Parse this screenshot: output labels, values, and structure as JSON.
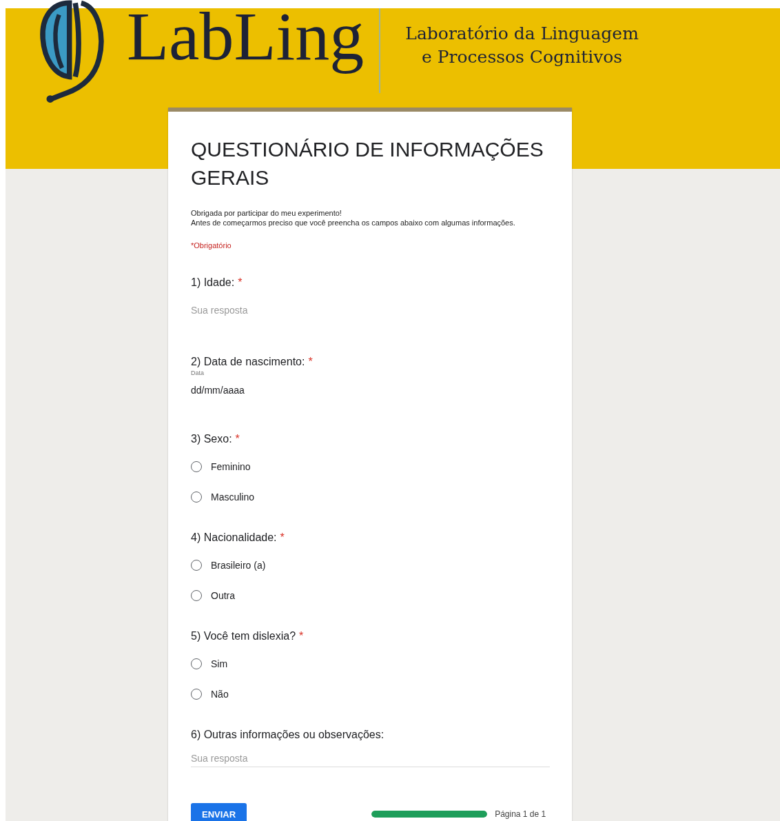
{
  "header": {
    "logo_text": "LabLing",
    "subtitle_lines": [
      "Laboratório da Linguagem",
      "e Processos Cognitivos"
    ]
  },
  "form": {
    "title": "QUESTIONÁRIO DE INFORMAÇÕES GERAIS",
    "description_lines": [
      "Obrigada por participar do meu experimento!",
      "Antes de começarmos preciso que você preencha os campos abaixo com algumas informações."
    ],
    "required_note": "*Obrigatório",
    "questions": [
      {
        "kind": "text",
        "label": "1) Idade:",
        "required_mark": "*",
        "placeholder": "Sua resposta"
      },
      {
        "kind": "date",
        "label": "2) Data de nascimento:",
        "required_mark": "*",
        "sublabel": "Data",
        "value": "dd/mm/aaaa"
      },
      {
        "kind": "radio",
        "label": "3) Sexo:",
        "required_mark": "*",
        "options": [
          {
            "label": "Feminino",
            "selected": false
          },
          {
            "label": "Masculino",
            "selected": false
          }
        ]
      },
      {
        "kind": "radio",
        "label": "4) Nacionalidade:",
        "required_mark": "*",
        "options": [
          {
            "label": "Brasileiro (a)",
            "selected": false
          },
          {
            "label": "Outra",
            "selected": false
          }
        ]
      },
      {
        "kind": "radio",
        "label": "5) Você tem dislexia?",
        "required_mark": "*",
        "options": [
          {
            "label": "Sim",
            "selected": false
          },
          {
            "label": "Não",
            "selected": false
          }
        ]
      },
      {
        "kind": "textarea",
        "label": "6) Outras informações ou observações:",
        "placeholder": "Sua resposta"
      }
    ],
    "submit_button": "ENVIAR",
    "progress": {
      "level": 1,
      "label": "Página 1 de 1"
    }
  }
}
